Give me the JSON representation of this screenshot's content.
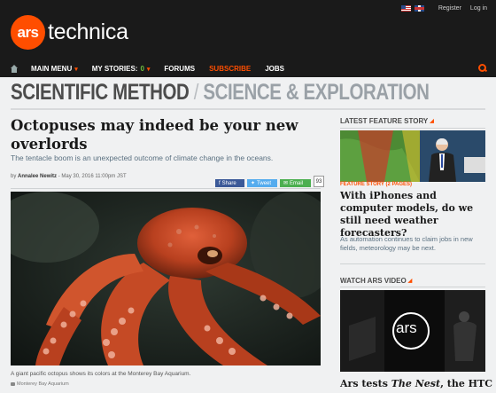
{
  "utility": {
    "register": "Register",
    "login": "Log in"
  },
  "logo": {
    "ars": "ars",
    "technica": "technica"
  },
  "nav": {
    "main_menu": "MAIN MENU",
    "my_stories": "MY STORIES:",
    "my_stories_count": "0",
    "forums": "FORUMS",
    "subscribe": "SUBSCRIBE",
    "jobs": "JOBS"
  },
  "section": {
    "main": "SCIENTIFIC METHOD",
    "slash": " / ",
    "sub": "SCIENCE & EXPLORATION"
  },
  "article": {
    "headline": "Octopuses may indeed be your new overlords",
    "dek": "The tentacle boom is an unexpected outcome of climate change in the oceans.",
    "byline_prefix": "by",
    "author": "Annalee Newitz",
    "date": "- May 30, 2016 11:00pm JST",
    "share_fb": "Share",
    "share_tw": "Tweet",
    "share_em": "Email",
    "comment_count": "93",
    "caption": "A giant pacific octopus shows its colors at the Monterey Bay Aquarium.",
    "credit": "Monterey Bay Aquarium"
  },
  "sidebar": {
    "feature_label": "LATEST FEATURE STORY",
    "feature_tag": "FEATURE STORY (2 PAGES)",
    "feature_headline": "With iPhones and computer models, do we still need weather forecasters?",
    "feature_dek": "As automation continues to claim jobs in new fields, meteorology may be next.",
    "video_label": "WATCH ARS VIDEO",
    "video_logo": "ars",
    "video_headline_prefix": "Ars tests ",
    "video_headline_title": "The Nest",
    "video_headline_suffix": ", the HTC"
  },
  "colors": {
    "accent": "#ff4e00",
    "header_bg": "#1a1a1a",
    "page_bg": "#f0f1f2",
    "dek": "#5a7080"
  }
}
